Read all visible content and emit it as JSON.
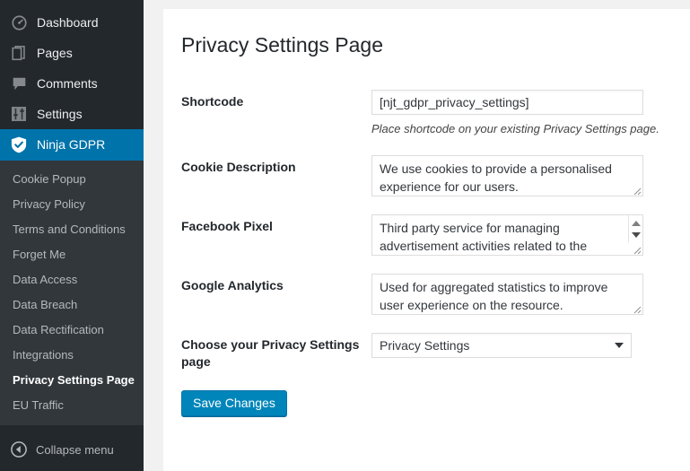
{
  "sidebar": {
    "top_items": [
      {
        "label": "Dashboard",
        "icon": "dashboard-icon",
        "active": false
      },
      {
        "label": "Pages",
        "icon": "pages-icon",
        "active": false
      },
      {
        "label": "Comments",
        "icon": "comments-icon",
        "active": false
      },
      {
        "label": "Settings",
        "icon": "settings-sliders-icon",
        "active": false
      },
      {
        "label": "Ninja GDPR",
        "icon": "shield-check-icon",
        "active": true
      }
    ],
    "submenu": [
      {
        "label": "Cookie Popup",
        "current": false
      },
      {
        "label": "Privacy Policy",
        "current": false
      },
      {
        "label": "Terms and Conditions",
        "current": false
      },
      {
        "label": "Forget Me",
        "current": false
      },
      {
        "label": "Data Access",
        "current": false
      },
      {
        "label": "Data Breach",
        "current": false
      },
      {
        "label": "Data Rectification",
        "current": false
      },
      {
        "label": "Integrations",
        "current": false
      },
      {
        "label": "Privacy Settings Page",
        "current": true
      },
      {
        "label": "EU Traffic",
        "current": false
      }
    ],
    "collapse_label": "Collapse menu",
    "colors": {
      "background": "#23282d",
      "submenu_background": "#32373c",
      "active_background": "#0073aa",
      "text": "#b4b9be",
      "active_text": "#ffffff"
    }
  },
  "page": {
    "title": "Privacy Settings Page"
  },
  "form": {
    "shortcode": {
      "label": "Shortcode",
      "value": "[njt_gdpr_privacy_settings]",
      "placeholder": "",
      "hint": "Place shortcode on your existing Privacy Settings page."
    },
    "cookie_description": {
      "label": "Cookie Description",
      "value": "We use cookies to provide a personalised experience for our users.",
      "placeholder": ""
    },
    "facebook_pixel": {
      "label": "Facebook Pixel",
      "value": "Third party service for managing advertisement activities related to the",
      "placeholder": ""
    },
    "google_analytics": {
      "label": "Google Analytics",
      "value": "Used for aggregated statistics to improve user experience on the resource.",
      "placeholder": ""
    },
    "privacy_page_select": {
      "label": "Choose your Privacy Settings page",
      "selected": "Privacy Settings",
      "options": [
        "Privacy Settings"
      ]
    },
    "save_button": "Save Changes"
  },
  "colors": {
    "accent": "#0085ba",
    "accent_dark": "#0073aa",
    "page_background": "#f1f1f1",
    "panel_background": "#ffffff",
    "heading_text": "#23282d"
  }
}
